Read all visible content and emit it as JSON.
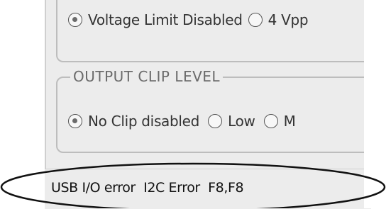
{
  "voltage_limit": {
    "options": [
      {
        "label": "Voltage Limit Disabled",
        "checked": true
      },
      {
        "label": "4 Vpp",
        "checked": false
      }
    ]
  },
  "output_clip_level": {
    "legend": "OUTPUT CLIP LEVEL",
    "options": [
      {
        "label": "No Clip disabled",
        "checked": true
      },
      {
        "label": "Low",
        "checked": false
      },
      {
        "label": "M",
        "checked": false
      }
    ]
  },
  "status_bar": {
    "text": "USB I/O error  I2C Error  F8,F8"
  }
}
